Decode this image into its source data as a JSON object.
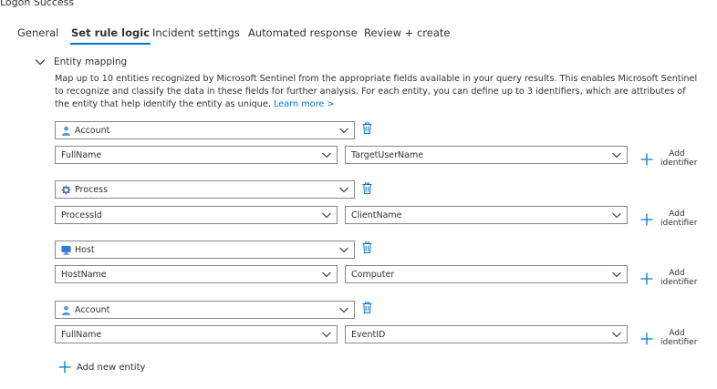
{
  "page": {
    "title": "Logon Success"
  },
  "tabs": [
    {
      "label": "General"
    },
    {
      "label": "Set rule logic"
    },
    {
      "label": "Incident settings"
    },
    {
      "label": "Automated response"
    },
    {
      "label": "Review + create"
    }
  ],
  "active_tab": "Set rule logic",
  "section": {
    "title": "Entity mapping",
    "description": "Map up to 10 entities recognized by Microsoft Sentinel from the appropriate fields available in your query results. This enables Microsoft Sentinel to recognize and classify the data in these fields for further analysis. For each entity, you can define up to 3 identifiers, which are attributes of the entity that help identify the entity as unique.",
    "learn_more": "Learn more >"
  },
  "entities": [
    {
      "type": "Account",
      "icon": "user-icon",
      "identifier": "FullName",
      "column": "TargetUserName"
    },
    {
      "type": "Process",
      "icon": "gear-icon",
      "identifier": "ProcessId",
      "column": "ClientName"
    },
    {
      "type": "Host",
      "icon": "monitor-icon",
      "identifier": "HostName",
      "column": "Computer"
    },
    {
      "type": "Account",
      "icon": "user-icon",
      "identifier": "FullName",
      "column": "EventID"
    }
  ],
  "add_identifier": {
    "line1": "Add",
    "line2": "identifier"
  },
  "add_entity_label": "Add new entity",
  "colors": {
    "accent": "#0078d4",
    "text": "#323130",
    "border": "#8a8886",
    "user_icon": "#4a9fd8",
    "monitor_icon": "#2b7cd3",
    "gear_icon": "#3a6fb7"
  }
}
